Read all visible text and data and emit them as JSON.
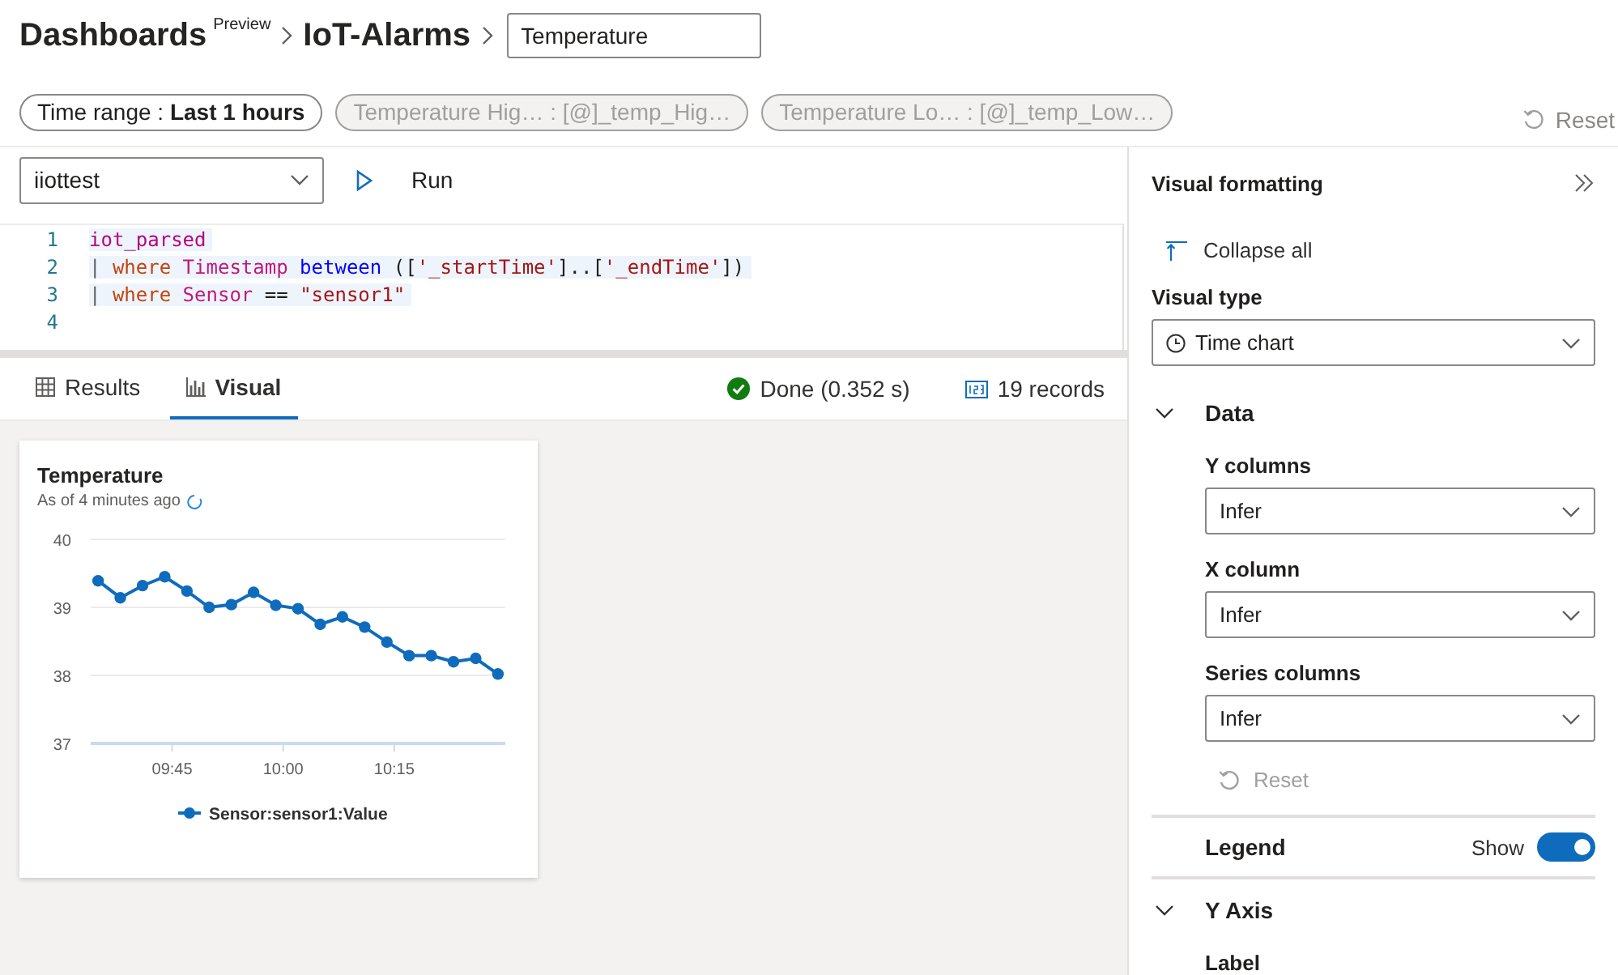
{
  "header": {
    "title": "Dashboards",
    "badge": "Preview",
    "breadcrumb": "IoT-Alarms",
    "tile_name": "Temperature"
  },
  "parameters": [
    {
      "text": "Time range : **Last 1 hours**",
      "disabled": false
    },
    {
      "text": "Temperature Hig… : [@]_temp_Hig…",
      "disabled": true
    },
    {
      "text": "Temperature Lo…  : [@]_temp_Low…",
      "disabled": true
    }
  ],
  "reset": {
    "label": "Reset"
  },
  "query": {
    "database": "iiottest",
    "run": "Run",
    "lines": [
      {
        "number": "1",
        "tokens": [
          {
            "kind": "table",
            "text": "iot_parsed"
          }
        ]
      },
      {
        "number": "2",
        "tokens": [
          {
            "kind": "pipe",
            "text": "| "
          },
          {
            "kind": "keyword",
            "text": "where"
          },
          {
            "kind": "column",
            "text": " Timestamp"
          },
          {
            "kind": "operator",
            "text": " between"
          },
          {
            "kind": "plain",
            "text": " (["
          },
          {
            "kind": "string",
            "text": "'_startTime'"
          },
          {
            "kind": "plain",
            "text": "]..["
          },
          {
            "kind": "string",
            "text": "'_endTime'"
          },
          {
            "kind": "plain",
            "text": "])"
          }
        ]
      },
      {
        "number": "3",
        "tokens": [
          {
            "kind": "pipe",
            "text": "| "
          },
          {
            "kind": "keyword",
            "text": "where"
          },
          {
            "kind": "column",
            "text": " Sensor"
          },
          {
            "kind": "plain",
            "text": " == "
          },
          {
            "kind": "string",
            "text": "\"sensor1\""
          }
        ]
      },
      {
        "number": "4"
      }
    ]
  },
  "result_tabs": [
    {
      "label": "Results",
      "selected": false
    },
    {
      "label": "Visual",
      "selected": true
    }
  ],
  "status": {
    "done": "Done (0.352 s)",
    "records": "19 records"
  },
  "tile": {
    "title": "Temperature",
    "subtitle": "As of 4 minutes ago",
    "chart_data": {
      "type": "line",
      "x": [
        575,
        578,
        581,
        584,
        587,
        590,
        593,
        596,
        599,
        602,
        605,
        608,
        611,
        614,
        617,
        620,
        623,
        626,
        629
      ],
      "series": [
        {
          "name": "Sensor:sensor1:Value",
          "color": "#0f6cbd",
          "marker": "circle",
          "values": [
            39.39,
            39.14,
            39.32,
            39.45,
            39.24,
            39.0,
            39.04,
            39.22,
            39.03,
            38.98,
            38.75,
            38.86,
            38.71,
            38.49,
            38.29,
            38.29,
            38.2,
            38.25,
            38.02
          ]
        }
      ],
      "xlim": [
        574,
        630
      ],
      "ylim": [
        37,
        40
      ],
      "xticks": [
        {
          "value": 585,
          "label": "09:45"
        },
        {
          "value": 600,
          "label": "10:00"
        },
        {
          "value": 615,
          "label": "10:15"
        }
      ],
      "yticks": [
        37,
        38,
        39,
        40
      ]
    }
  },
  "format": {
    "title": "Visual formatting",
    "collapse_all": "Collapse all",
    "visual_type": {
      "label": "Visual type",
      "value": "Time chart"
    },
    "sections": [
      {
        "kind": "group",
        "title": "Data",
        "expanded": true,
        "fields": [
          {
            "label": "Y columns",
            "value": "Infer"
          },
          {
            "label": "X column",
            "value": "Infer"
          },
          {
            "label": "Series columns",
            "value": "Infer"
          }
        ],
        "reset": "Reset"
      },
      {
        "kind": "toggle",
        "title": "Legend",
        "state_label": "Show",
        "on": true
      },
      {
        "kind": "group",
        "title": "Y Axis",
        "expanded": true,
        "fields": [
          {
            "label": "Label"
          }
        ]
      }
    ]
  }
}
